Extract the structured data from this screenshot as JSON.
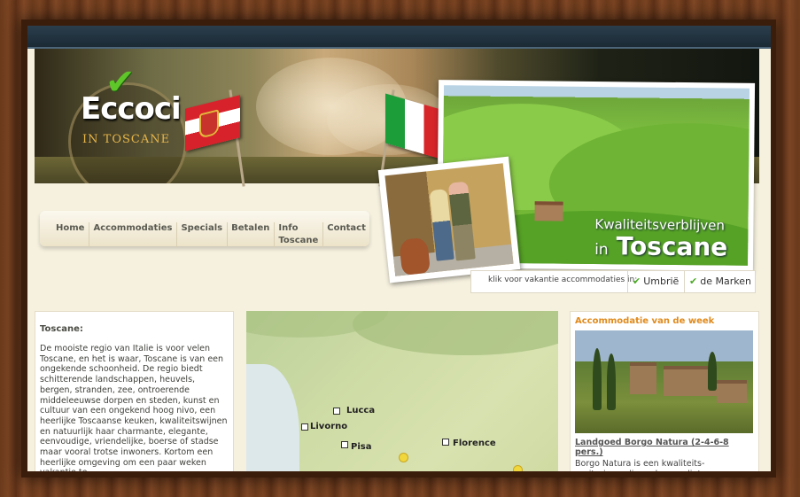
{
  "logo": {
    "title": "Eccoci",
    "subtitle": "IN TOSCANE"
  },
  "banner": {
    "slogan_line1": "Kwaliteitsverblijven",
    "slogan_prefix": "in",
    "slogan_main": "Toscane"
  },
  "nav": {
    "items": [
      {
        "label": "Home"
      },
      {
        "label": "Accommodaties"
      },
      {
        "label": "Specials"
      },
      {
        "label": "Betalen"
      },
      {
        "label": "Info Toscane"
      },
      {
        "label": "Contact"
      }
    ]
  },
  "regions": {
    "label": "klik voor vakantie accommodaties in:",
    "items": [
      {
        "label": "Umbrië"
      },
      {
        "label": "de Marken"
      }
    ]
  },
  "intro": {
    "title": "Toscane:",
    "text": "De mooiste regio van Italie is voor velen Toscane, en het is waar, Toscane is van een ongekende schoonheid. De regio biedt schitterende landschappen, heuvels, bergen, stranden, zee, ontroerende middeleeuwse dorpen en steden, kunst en cultuur van een ongekend hoog nivo, een heerlijke Toscaanse keuken, kwaliteitswijnen en natuurlijk haar charmante, elegante, eenvoudige, vriendelijke, boerse of stadse maar vooral trotse inwoners. Kortom een heerlijke omgeving om een paar weken vakantie te"
  },
  "map": {
    "cities": [
      {
        "label": "Lucca"
      },
      {
        "label": "Livorno"
      },
      {
        "label": "Pisa"
      },
      {
        "label": "Florence"
      }
    ]
  },
  "week": {
    "title": "Accommodatie van de week",
    "link": "Landgoed Borgo Natura (2-4-6-8 pers.)",
    "text": "Borgo Natura is een kwaliteits-agriturisme die verborgen ligt op een"
  },
  "colors": {
    "accent_orange": "#e08a1c",
    "check_green": "#5fc629",
    "topbar": "#1b2a35"
  }
}
